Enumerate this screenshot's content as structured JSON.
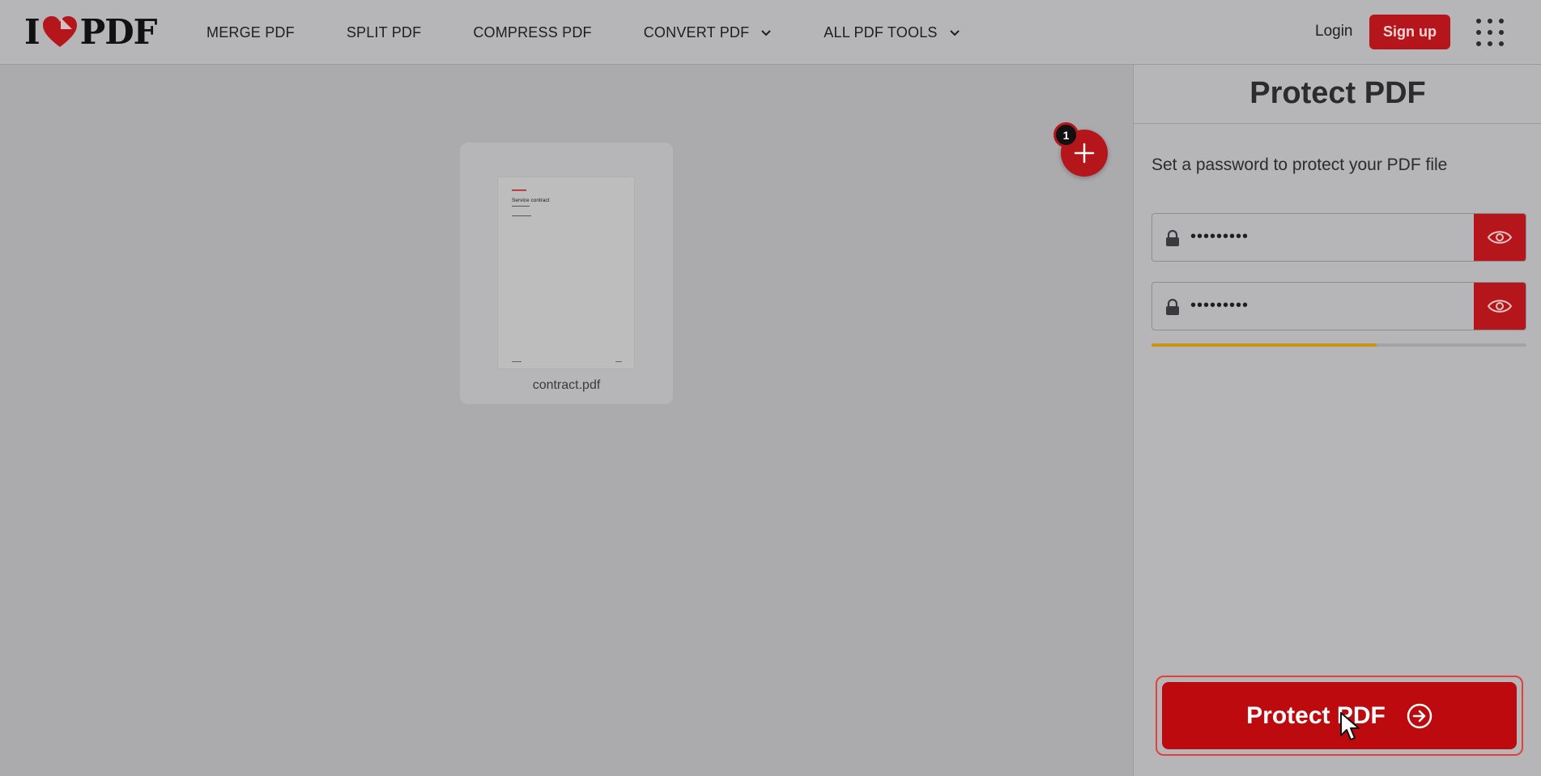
{
  "header": {
    "logo_text_left": "I",
    "logo_text_right": "PDF",
    "nav": [
      {
        "label": "MERGE PDF",
        "dropdown": false
      },
      {
        "label": "SPLIT PDF",
        "dropdown": false
      },
      {
        "label": "COMPRESS PDF",
        "dropdown": false
      },
      {
        "label": "CONVERT PDF",
        "dropdown": true
      },
      {
        "label": "ALL PDF TOOLS",
        "dropdown": true
      }
    ],
    "login_label": "Login",
    "signup_label": "Sign up",
    "apps_icon": "grid-icon"
  },
  "workspace": {
    "file_count": "1",
    "files": [
      {
        "name": "contract.pdf",
        "thumb_title": "Service contract"
      }
    ],
    "add_icon": "plus-icon"
  },
  "sidebar": {
    "title": "Protect PDF",
    "instruction": "Set a password to protect your PDF file",
    "password": {
      "value": "•••••••••",
      "icon": "lock-icon",
      "toggle_icon": "eye-icon"
    },
    "repeat_password": {
      "value": "•••••••••",
      "icon": "lock-icon",
      "toggle_icon": "eye-icon"
    },
    "strength_fraction": 0.6,
    "action_label": "Protect PDF",
    "action_icon": "arrow-right-circle-icon"
  },
  "colors": {
    "brand_red": "#b5161c",
    "action_red": "#bd0a0f",
    "strength_fill": "#c99412"
  }
}
